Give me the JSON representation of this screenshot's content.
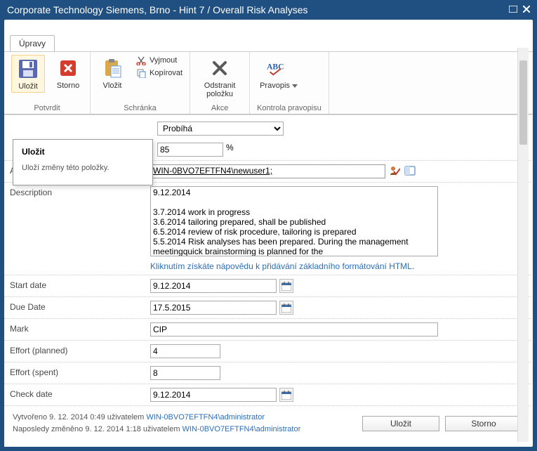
{
  "title": "Corporate Technology Siemens, Brno - Hint 7 / Overall Risk Analyses",
  "tab": "Úpravy",
  "ribbon": {
    "save_label": "Uložit",
    "cancel_label": "Storno",
    "confirm_group": "Potvrdit",
    "paste_label": "Vložit",
    "cut_label": "Vyjmout",
    "copy_label": "Kopírovat",
    "clipboard_group": "Schránka",
    "delete_label": "Odstranit položku",
    "actions_group": "Akce",
    "spell_label": "Pravopis",
    "spell_group": "Kontrola pravopisu"
  },
  "tooltip": {
    "title": "Uložit",
    "desc": "Uloží změny této položky."
  },
  "form": {
    "status_label": "",
    "status_value": "Probíhá",
    "percent_value": "85",
    "percent_sign": "%",
    "assigned_label": "Assigned to",
    "assigned_value": "WIN-0BVO7EFTFN4\\newuser1;",
    "description_label": "Description",
    "description_value": "9.12.2014\n\n3.7.2014 work in progress\n3.6.2014 tailoring prepared, shall be published\n6.5.2014 review of risk procedure, tailoring is prepared\n5.5.2014 Risk analyses has been prepared. During the management meetingquick brainstorming is planned for the",
    "html_hint": "Kliknutím získáte nápovědu k přidávání základního formátování HTML.",
    "start_label": "Start date",
    "start_value": "9.12.2014",
    "due_label": "Due Date",
    "due_value": "17.5.2015",
    "mark_label": "Mark",
    "mark_value": "CIP",
    "effort_planned_label": "Effort (planned)",
    "effort_planned_value": "4",
    "effort_spent_label": "Effort (spent)",
    "effort_spent_value": "8",
    "check_label": "Check date",
    "check_value": "9.12.2014"
  },
  "footer": {
    "created_prefix": "Vytvořeno 9. 12. 2014 0:49 uživatelem ",
    "created_user": "WIN-0BVO7EFTFN4\\administrator",
    "modified_prefix": "Naposledy změněno 9. 12. 2014 1:18 uživatelem ",
    "modified_user": "WIN-0BVO7EFTFN4\\administrator",
    "save_btn": "Uložit",
    "cancel_btn": "Storno"
  }
}
